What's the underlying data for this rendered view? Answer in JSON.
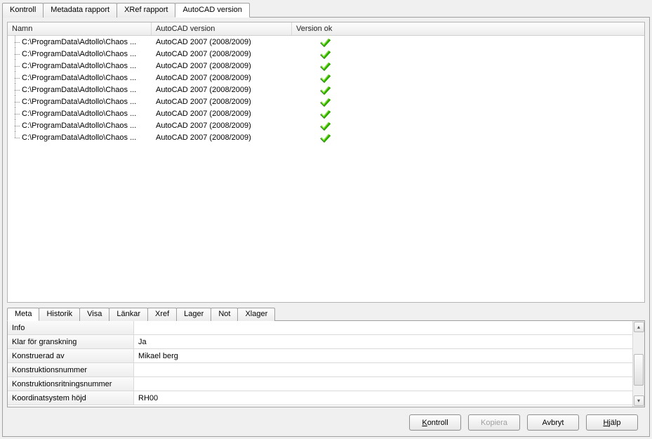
{
  "topTabs": [
    {
      "label": "Kontroll",
      "active": false
    },
    {
      "label": "Metadata rapport",
      "active": false
    },
    {
      "label": "XRef rapport",
      "active": false
    },
    {
      "label": "AutoCAD version",
      "active": true
    }
  ],
  "columns": {
    "name": "Namn",
    "version": "AutoCAD version",
    "ok": "Version ok"
  },
  "rows": [
    {
      "name": "C:\\ProgramData\\Adtollo\\Chaos ...",
      "version": "AutoCAD 2007 (2008/2009)",
      "ok": true
    },
    {
      "name": "C:\\ProgramData\\Adtollo\\Chaos ...",
      "version": "AutoCAD 2007 (2008/2009)",
      "ok": true
    },
    {
      "name": "C:\\ProgramData\\Adtollo\\Chaos ...",
      "version": "AutoCAD 2007 (2008/2009)",
      "ok": true
    },
    {
      "name": "C:\\ProgramData\\Adtollo\\Chaos ...",
      "version": "AutoCAD 2007 (2008/2009)",
      "ok": true
    },
    {
      "name": "C:\\ProgramData\\Adtollo\\Chaos ...",
      "version": "AutoCAD 2007 (2008/2009)",
      "ok": true
    },
    {
      "name": "C:\\ProgramData\\Adtollo\\Chaos ...",
      "version": "AutoCAD 2007 (2008/2009)",
      "ok": true
    },
    {
      "name": "C:\\ProgramData\\Adtollo\\Chaos ...",
      "version": "AutoCAD 2007 (2008/2009)",
      "ok": true
    },
    {
      "name": "C:\\ProgramData\\Adtollo\\Chaos ...",
      "version": "AutoCAD 2007 (2008/2009)",
      "ok": true
    },
    {
      "name": "C:\\ProgramData\\Adtollo\\Chaos ...",
      "version": "AutoCAD 2007 (2008/2009)",
      "ok": true
    }
  ],
  "lowerTabs": [
    {
      "label": "Meta",
      "active": true
    },
    {
      "label": "Historik",
      "active": false
    },
    {
      "label": "Visa",
      "active": false
    },
    {
      "label": "Länkar",
      "active": false
    },
    {
      "label": "Xref",
      "active": false
    },
    {
      "label": "Lager",
      "active": false
    },
    {
      "label": "Not",
      "active": false
    },
    {
      "label": "Xlager",
      "active": false
    }
  ],
  "props": [
    {
      "label": "Info",
      "value": ""
    },
    {
      "label": "Klar för granskning",
      "value": "Ja"
    },
    {
      "label": "Konstruerad av",
      "value": "Mikael berg"
    },
    {
      "label": "Konstruktionsnummer",
      "value": ""
    },
    {
      "label": "Konstruktionsritningsnummer",
      "value": ""
    },
    {
      "label": "Koordinatsystem höjd",
      "value": "RH00"
    }
  ],
  "buttons": {
    "kontroll": "Kontroll",
    "kopiera": "Kopiera",
    "avbryt": "Avbryt",
    "hjalp": "Hjälp"
  },
  "icons": {
    "check": "check-icon"
  }
}
